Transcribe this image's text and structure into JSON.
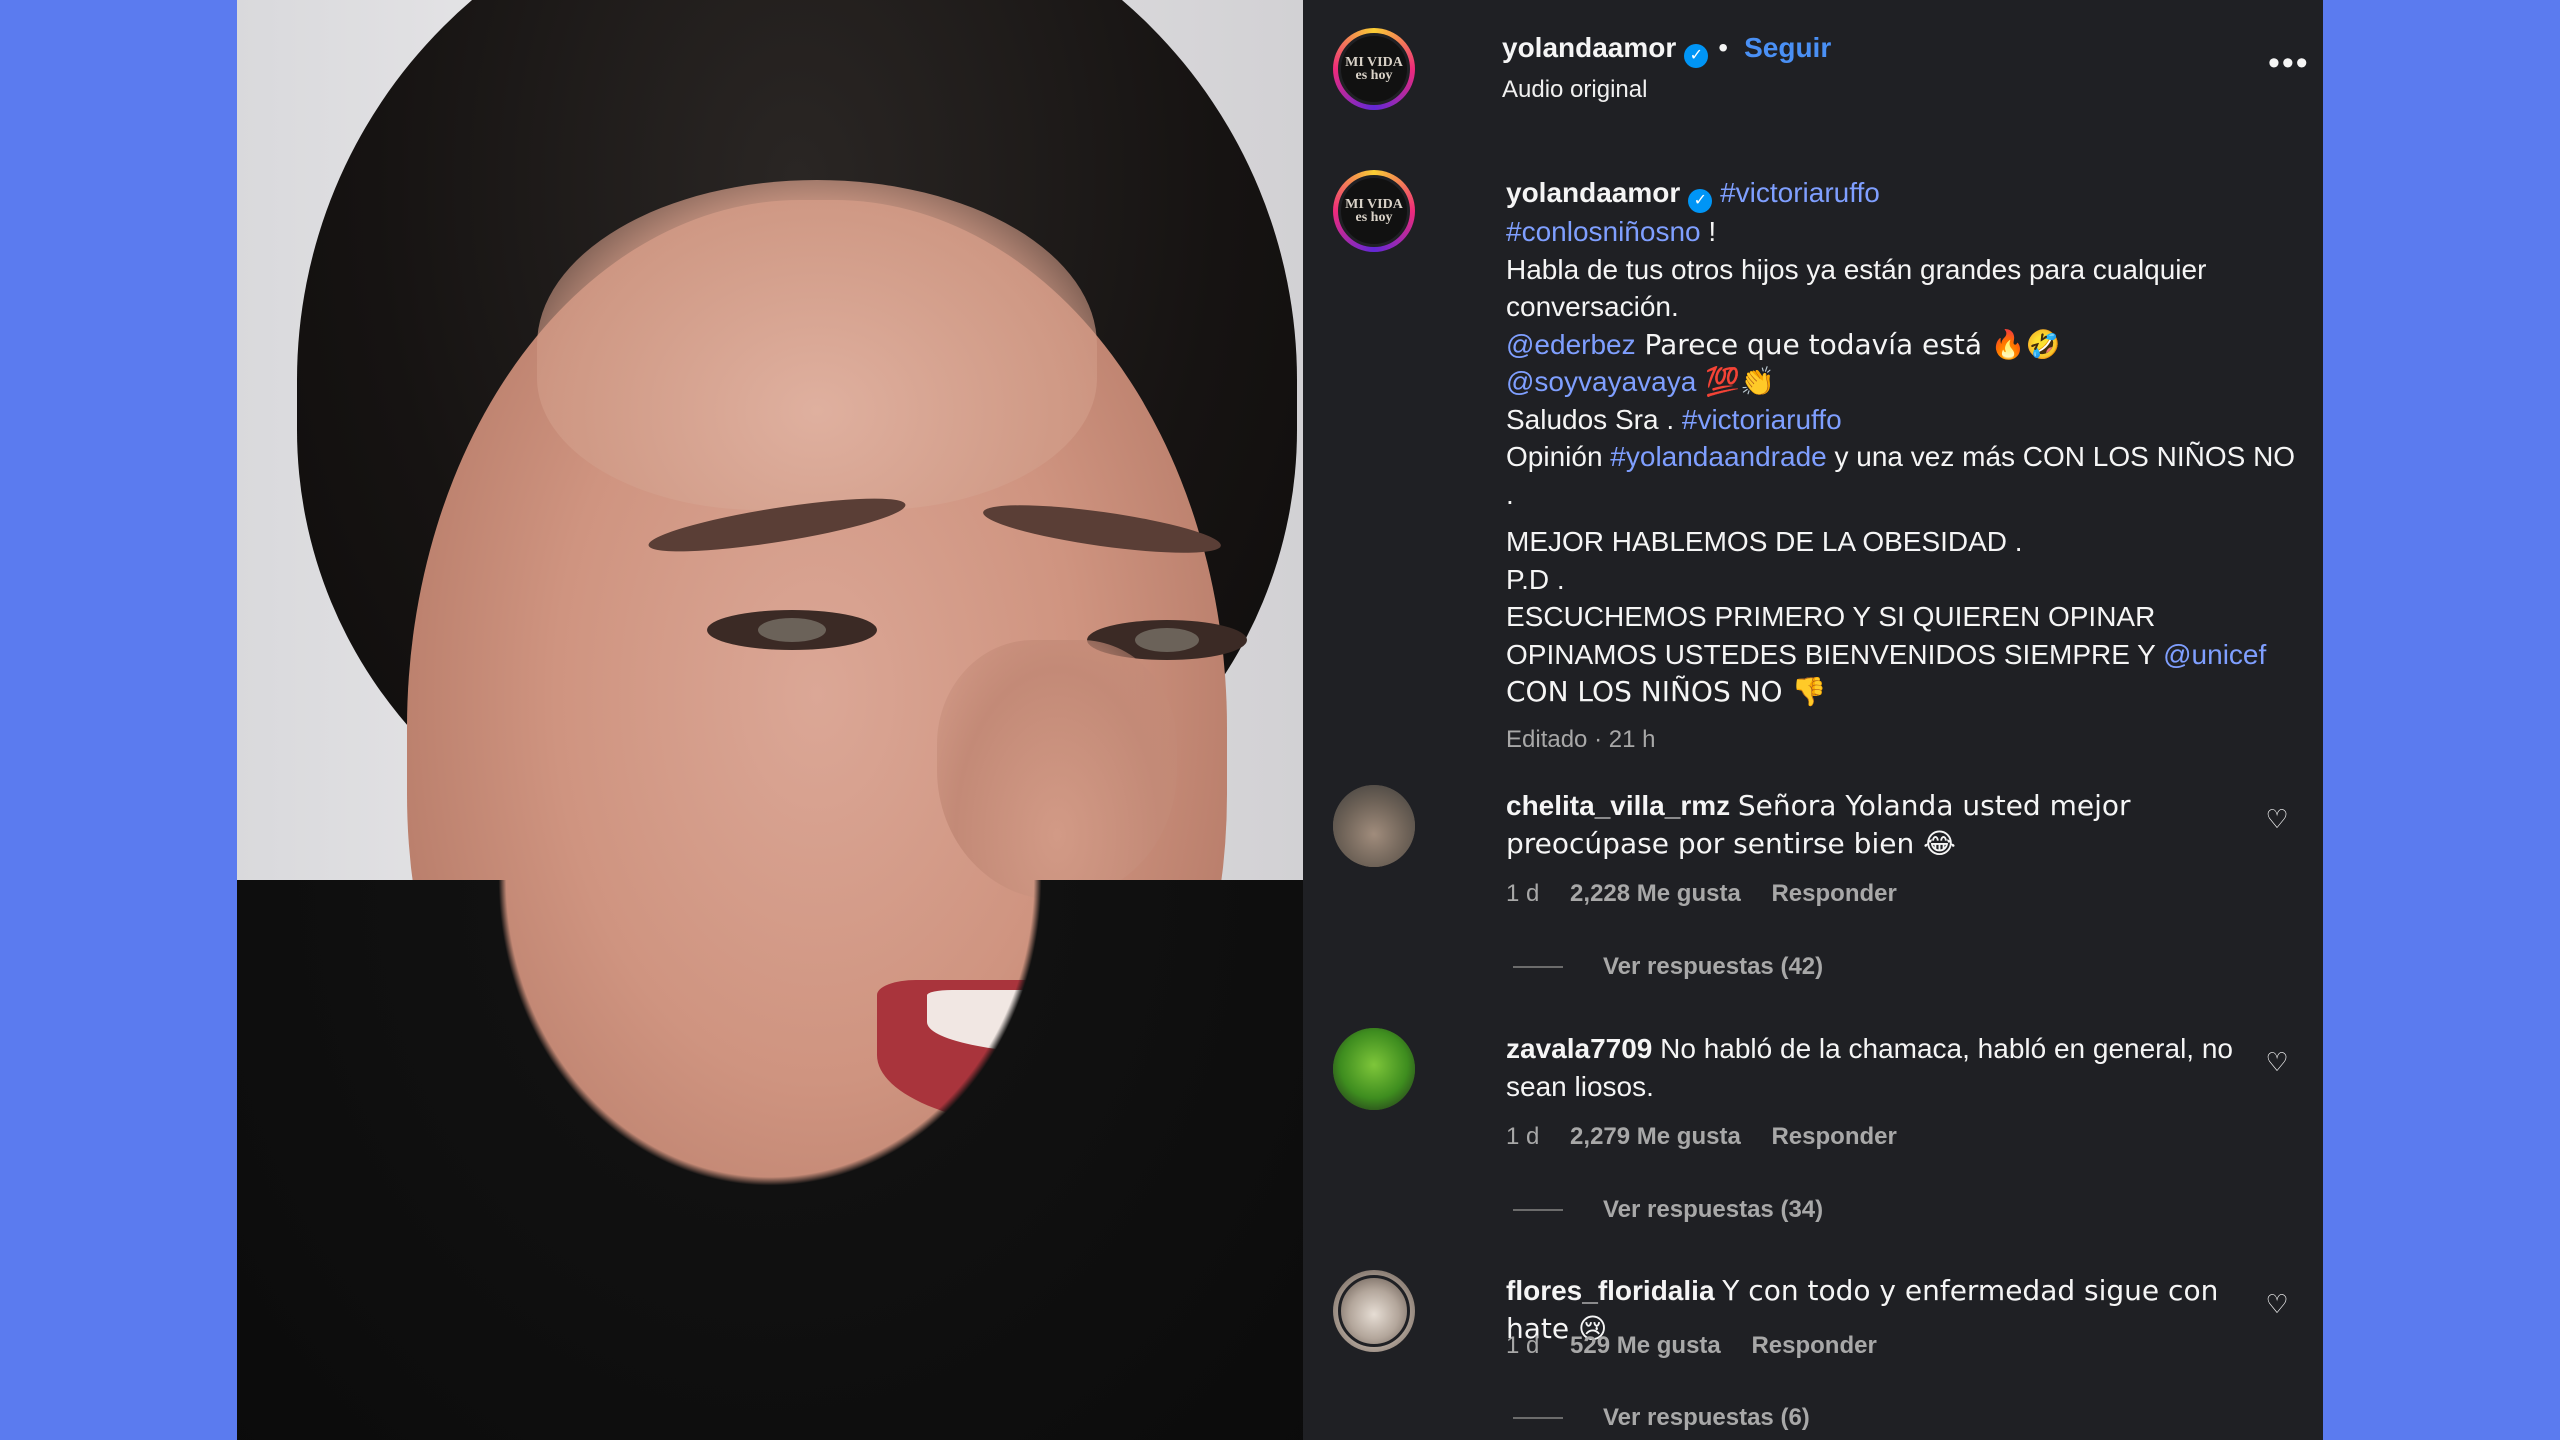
{
  "header": {
    "username": "yolandaamor",
    "follow_label": "Seguir",
    "separator": "•",
    "audio_label": "Audio original",
    "more_icon": "•••",
    "avatar_text": "MI VIDA es hoy"
  },
  "caption": {
    "username": "yolandaamor",
    "tag1": "#victoriaruffo",
    "tag2": "#conlosniñosno",
    "tag2_suffix": " !",
    "line1": "Habla de tus otros hijos ya están grandes para cualquier conversación.",
    "mention1": "@ederbez",
    "mention1_text": " Parece que todavía está 🔥🤣",
    "mention2": "@soyvayavaya",
    "mention2_text": " 💯👏",
    "saludos": "Saludos Sra . ",
    "tag3": "#victoriaruffo",
    "opinion_prefix": "Opinión ",
    "tag4": "#yolandaandrade",
    "opinion_suffix": " y una vez más CON LOS NIÑOS NO",
    "dot_line": ".",
    "mejor": "MEJOR HABLEMOS DE LA OBESIDAD .",
    "pd": "P.D .",
    "escuchemos": "ESCUCHEMOS PRIMERO Y SI QUIEREN OPINAR OPINAMOS USTEDES BIENVENIDOS SIEMPRE Y ",
    "mention3": "@unicef",
    "ending": " CON LOS NIÑOS NO 👎",
    "meta": "Editado · 21 h"
  },
  "comments": [
    {
      "username": "chelita_villa_rmz",
      "text": "Señora Yolanda usted mejor preocúpase por sentirse bien 😂",
      "time": "1 d",
      "likes": "2,228 Me gusta",
      "reply": "Responder",
      "view_replies": "Ver respuestas (42)"
    },
    {
      "username": "zavala7709",
      "text": "No habló de la chamaca, habló en general, no sean liosos.",
      "time": "1 d",
      "likes": "2,279 Me gusta",
      "reply": "Responder",
      "view_replies": "Ver respuestas (34)"
    },
    {
      "username": "flores_floridalia",
      "text": "Y con todo y enfermedad sigue con hate 😢",
      "time": "1 d",
      "likes": "529 Me gusta",
      "reply": "Responder",
      "view_replies": "Ver respuestas (6)"
    }
  ],
  "icons": {
    "verified": "✓",
    "heart": "♡"
  },
  "colors": {
    "background": "#5b7bef",
    "panel": "#1f2024",
    "link": "#7f9fff",
    "follow": "#4a90f5",
    "verified": "#0095f6"
  }
}
